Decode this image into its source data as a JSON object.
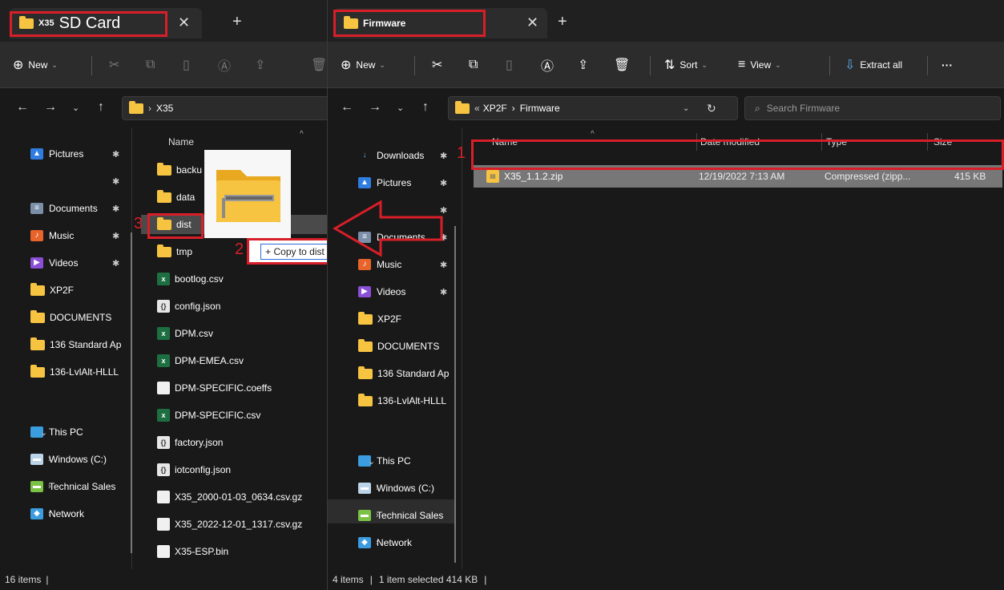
{
  "left": {
    "tab_prefix": "X35",
    "tab_title": "SD Card",
    "toolbar_new": "New",
    "breadcrumb": "X35",
    "nav_items": [
      {
        "label": "Pictures",
        "icon": "pictures-icon"
      },
      {
        "label": "",
        "icon": "pin-icon"
      },
      {
        "label": "Documents",
        "icon": "documents-icon"
      },
      {
        "label": "Music",
        "icon": "music-icon"
      },
      {
        "label": "Videos",
        "icon": "videos-icon"
      },
      {
        "label": "XP2F",
        "icon": "folder-icon"
      },
      {
        "label": "DOCUMENTS",
        "icon": "folder-icon"
      },
      {
        "label": "136 Standard Ap",
        "icon": "folder-icon"
      },
      {
        "label": "136-LvlAlt-HLLL",
        "icon": "folder-icon"
      },
      {
        "label": "This PC",
        "icon": "this-pc-icon"
      },
      {
        "label": "Windows (C:)",
        "icon": "drive-icon"
      },
      {
        "label": "Technical Sales",
        "icon": "network-drive-icon"
      },
      {
        "label": "Network",
        "icon": "network-icon"
      }
    ],
    "col_name": "Name",
    "files": [
      {
        "name": "backu",
        "type": "folder"
      },
      {
        "name": "data",
        "type": "folder"
      },
      {
        "name": "dist",
        "type": "folder"
      },
      {
        "name": "tmp",
        "type": "folder"
      },
      {
        "name": "bootlog.csv",
        "type": "csv"
      },
      {
        "name": "config.json",
        "type": "json"
      },
      {
        "name": "DPM.csv",
        "type": "csv"
      },
      {
        "name": "DPM-EMEA.csv",
        "type": "csv"
      },
      {
        "name": "DPM-SPECIFIC.coeffs",
        "type": "file"
      },
      {
        "name": "DPM-SPECIFIC.csv",
        "type": "csv"
      },
      {
        "name": "factory.json",
        "type": "json"
      },
      {
        "name": "iotconfig.json",
        "type": "json"
      },
      {
        "name": "X35_2000-01-03_0634.csv.gz",
        "type": "file"
      },
      {
        "name": "X35_2022-12-01_1317.csv.gz",
        "type": "file"
      },
      {
        "name": "X35-ESP.bin",
        "type": "file"
      }
    ],
    "status": "16 items",
    "drag_tooltip": "+ Copy to dist"
  },
  "right": {
    "tab_title": "Firmware",
    "toolbar": {
      "new": "New",
      "sort": "Sort",
      "view": "View",
      "extract": "Extract all",
      "more": "···"
    },
    "breadcrumb_prefix": "«",
    "breadcrumb_parent": "XP2F",
    "breadcrumb_current": "Firmware",
    "search_placeholder": "Search Firmware",
    "nav_items": [
      {
        "label": "Downloads",
        "icon": "downloads-icon"
      },
      {
        "label": "Pictures",
        "icon": "pictures-icon"
      },
      {
        "label": "",
        "icon": "pin-icon"
      },
      {
        "label": "Documents",
        "icon": "documents-icon"
      },
      {
        "label": "Music",
        "icon": "music-icon"
      },
      {
        "label": "Videos",
        "icon": "videos-icon"
      },
      {
        "label": "XP2F",
        "icon": "folder-icon"
      },
      {
        "label": "DOCUMENTS",
        "icon": "folder-icon"
      },
      {
        "label": "136 Standard Ap",
        "icon": "folder-icon"
      },
      {
        "label": "136-LvlAlt-HLLL",
        "icon": "folder-icon"
      },
      {
        "label": "This PC",
        "icon": "this-pc-icon"
      },
      {
        "label": "Windows (C:)",
        "icon": "drive-icon"
      },
      {
        "label": "Technical Sales",
        "icon": "network-drive-icon"
      },
      {
        "label": "Network",
        "icon": "network-icon"
      }
    ],
    "columns": {
      "name": "Name",
      "date": "Date modified",
      "type": "Type",
      "size": "Size"
    },
    "files": [
      {
        "name": "X35_1.1.2.zip",
        "date": "12/19/2022 7:13 AM",
        "type": "Compressed (zipp...",
        "size": "415 KB"
      }
    ],
    "status_items": "4 items",
    "status_selected": "1 item selected  414 KB"
  },
  "annotations": {
    "n1": "1",
    "n2": "2",
    "n3": "3"
  },
  "colors": {
    "annotation_red": "#d81e28",
    "folder_yellow": "#f7c441",
    "selected_row": "#777777"
  }
}
